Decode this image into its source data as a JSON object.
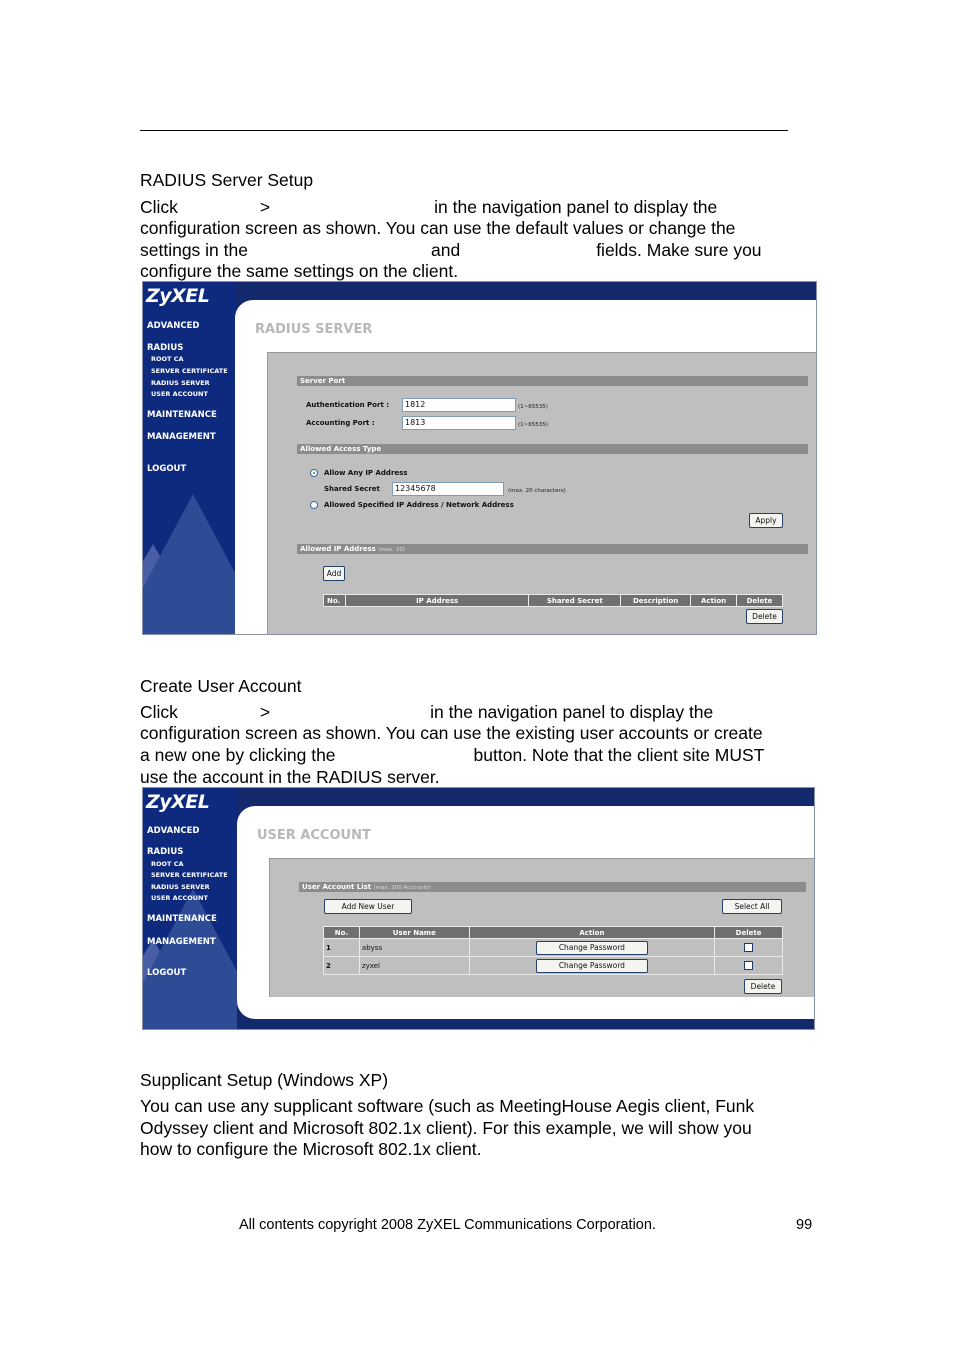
{
  "section1": {
    "title": "RADIUS Server Setup",
    "para_lines": [
      [
        "Click",
        ">",
        "in the navigation panel to display the"
      ],
      "configuration screen as shown. You can use the default values or change the",
      [
        "settings in the",
        "and",
        "fields. Make sure you"
      ],
      "configure the same settings on the client."
    ]
  },
  "shot1": {
    "logo": "ZyXEL",
    "nav": {
      "advanced": "ADVANCED",
      "radius": "RADIUS",
      "root_ca": "ROOT CA",
      "server_certificate": "SERVER CERTIFICATE",
      "radius_server": "RADIUS SERVER",
      "user_account": "USER ACCOUNT",
      "maintenance": "MAINTENANCE",
      "management": "MANAGEMENT",
      "logout": "LOGOUT"
    },
    "heading": "RADIUS SERVER",
    "server_port": {
      "title": "Server Port",
      "auth_label": "Authentication Port :",
      "auth_value": "1812",
      "auth_hint": "(1~65535)",
      "acct_label": "Accounting Port :",
      "acct_value": "1813",
      "acct_hint": "(1~65535)"
    },
    "access_type": {
      "title": "Allowed Access Type",
      "option_any": "Allow Any IP Address",
      "option_any_selected": true,
      "shared_secret_label": "Shared Secret",
      "shared_secret_value": "12345678",
      "shared_secret_hint": "(max. 20 characters)",
      "option_specified": "Allowed Specified IP Address / Network Address",
      "apply": "Apply"
    },
    "allowed_ip": {
      "title": "Allowed IP Address",
      "title_hint": "(max. 20)",
      "add": "Add",
      "columns": [
        "No.",
        "IP Address",
        "Shared Secret",
        "Description",
        "Action",
        "Delete"
      ],
      "delete": "Delete"
    }
  },
  "section2": {
    "title": "Create User Account",
    "para_lines": [
      [
        "Click",
        ">",
        "in the navigation panel to display the"
      ],
      "configuration screen as shown. You can use the existing user accounts or create",
      [
        "a new one by clicking the",
        "button. Note that the client site MUST"
      ],
      "use the account in the RADIUS server."
    ]
  },
  "shot2": {
    "logo": "ZyXEL",
    "nav": {
      "advanced": "ADVANCED",
      "radius": "RADIUS",
      "root_ca": "ROOT CA",
      "server_certificate": "SERVER CERTIFICATE",
      "radius_server": "RADIUS SERVER",
      "user_account": "USER ACCOUNT",
      "maintenance": "MAINTENANCE",
      "management": "MANAGEMENT",
      "logout": "LOGOUT"
    },
    "heading": "USER ACCOUNT",
    "list": {
      "title": "User Account List",
      "title_hint": "(max. 200 Accounts)",
      "add_new_user": "Add New User",
      "select_all": "Select All",
      "columns": [
        "No.",
        "User Name",
        "Action",
        "Delete"
      ],
      "rows": [
        {
          "no": "1",
          "user": "abyss",
          "action": "Change Password",
          "checked": false
        },
        {
          "no": "2",
          "user": "zyxel",
          "action": "Change Password",
          "checked": false
        }
      ],
      "delete": "Delete"
    }
  },
  "section3": {
    "title": "Supplicant Setup (Windows XP)",
    "para_lines": [
      "You can use any supplicant software (such as MeetingHouse Aegis client, Funk",
      "Odyssey client and Microsoft 802.1x client). For this example, we will show you",
      "how to configure the Microsoft 802.1x client."
    ]
  },
  "footer": {
    "copyright": "All contents copyright 2008 ZyXEL Communications Corporation.",
    "page_number": "99"
  }
}
